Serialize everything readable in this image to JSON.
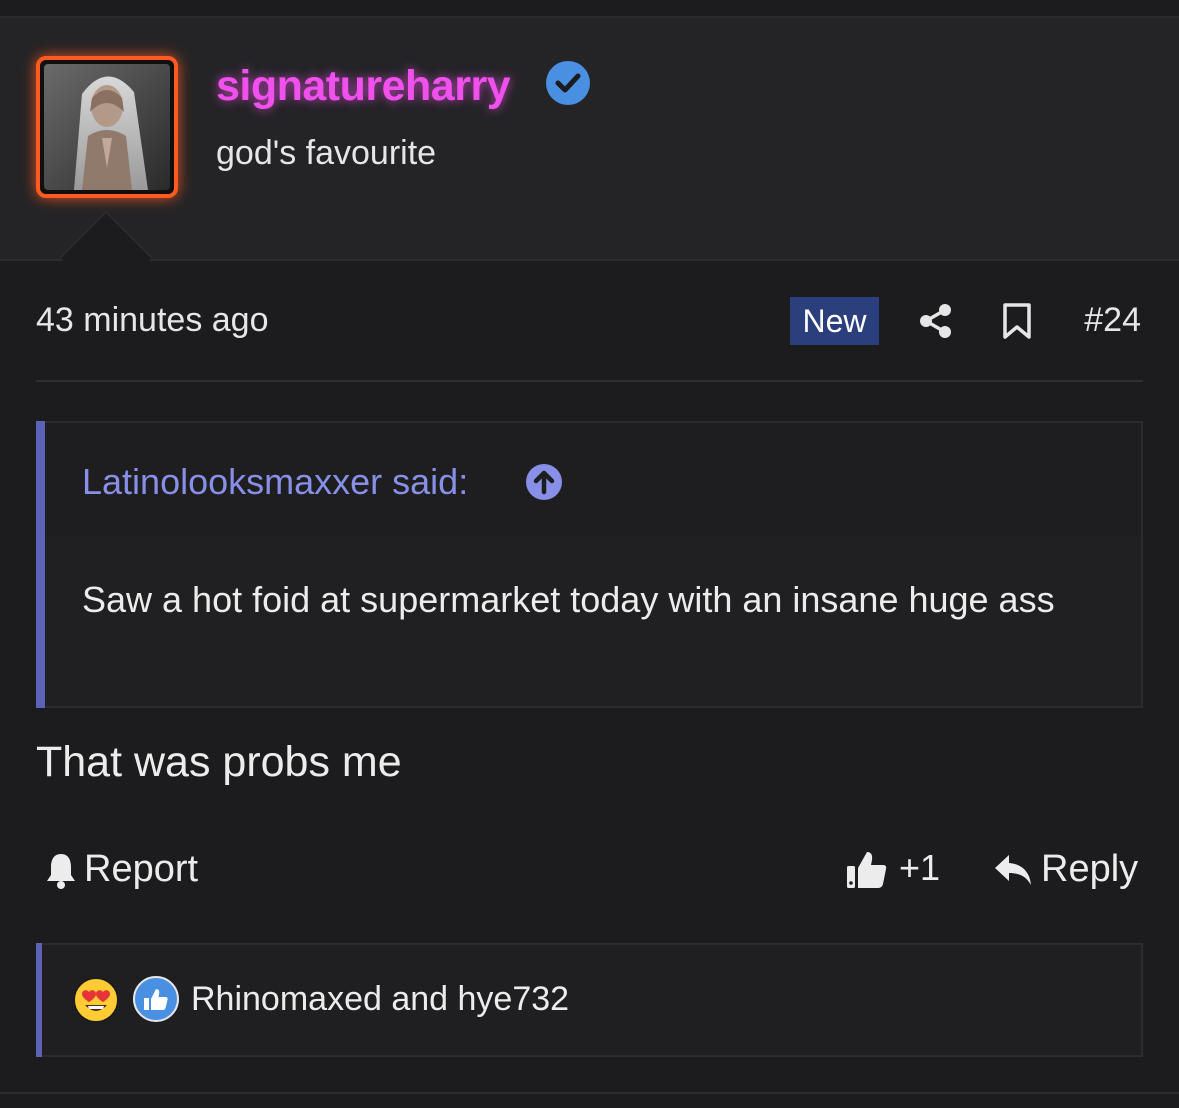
{
  "user": {
    "username": "signatureharry",
    "title": "god's favourite",
    "verified": true,
    "username_color": "#f050ec",
    "avatar_border_color": "#ff5a1f"
  },
  "post_meta": {
    "timestamp": "43 minutes ago",
    "badge": "New",
    "share_icon": "share-icon",
    "bookmark_icon": "bookmark-icon",
    "post_number": "#24"
  },
  "quote": {
    "author": "Latinolooksmaxxer said:",
    "jump_icon": "arrow-up-circle-icon",
    "text": "Saw a hot foid at supermarket today with an insane huge ass"
  },
  "body": {
    "text": "That was probs me"
  },
  "actions": {
    "report_label": "Report",
    "like_count": "+1",
    "reply_label": "Reply"
  },
  "reactions": {
    "icons": [
      "heart-eyes-emoji-icon",
      "thumbs-up-reaction-icon"
    ],
    "users": "Rhinomaxed and hye732"
  },
  "colors": {
    "background": "#1c1c1e",
    "header_background": "#242426",
    "accent": "#5b63b8",
    "badge": "#2b3f7d",
    "verified": "#4a90e2"
  }
}
